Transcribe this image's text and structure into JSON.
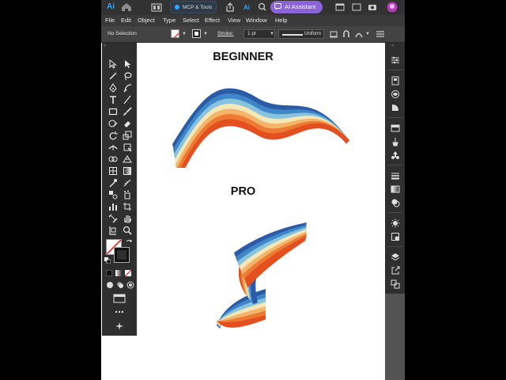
{
  "titlebar": {
    "app_badge": "Ai",
    "mcp_label": "MCP & Tools",
    "assistant_label": "AI Assistant"
  },
  "menu": {
    "items": [
      "File",
      "Edit",
      "Object",
      "Type",
      "Select",
      "Effect",
      "View",
      "Window",
      "Help"
    ]
  },
  "control_bar": {
    "selection_status": "No Selection",
    "stroke_label": "Stroke:",
    "stroke_weight": "1 pt",
    "profile": "Uniform"
  },
  "canvas": {
    "heading_top": "BEGINNER",
    "heading_bottom": "PRO"
  },
  "colors": {
    "accent": "#31a8ff",
    "assistant": "#8b64d8",
    "ribbon_bands": [
      "#2b5aa6",
      "#3f86c8",
      "#86c3df",
      "#f5e7b8",
      "#f3b56a",
      "#ed7a32",
      "#e34f1f"
    ]
  },
  "tools": [
    "selection-tool",
    "direct-selection-tool",
    "magic-wand-tool",
    "lasso-tool",
    "pen-tool",
    "curvature-tool",
    "type-tool",
    "line-tool",
    "rectangle-tool",
    "paintbrush-tool",
    "shaper-tool",
    "eraser-tool",
    "rotate-tool",
    "scale-tool",
    "width-tool",
    "free-transform-tool",
    "shape-builder-tool",
    "perspective-tool",
    "mesh-tool",
    "gradient-tool",
    "eyedropper-tool",
    "blend-tool",
    "symbol-sprayer-tool",
    "slice-tool",
    "column-graph-tool",
    "artboard-tool",
    "hand-tool",
    "zoom-tool"
  ],
  "right_panel": [
    "properties-icon",
    "layers-icon",
    "libraries-icon",
    "character-icon",
    "swatches-icon",
    "brushes-icon",
    "symbols-icon",
    "stroke-icon",
    "gradient-icon",
    "transparency-icon",
    "appearance-icon",
    "graphic-styles-icon",
    "layers-stack-icon",
    "export-icon",
    "artboards-icon"
  ]
}
